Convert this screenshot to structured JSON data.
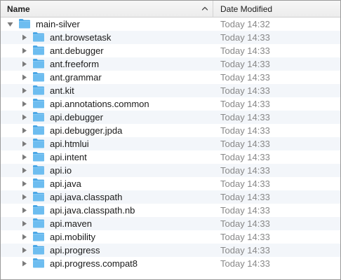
{
  "header": {
    "name_label": "Name",
    "date_label": "Date Modified",
    "sort_icon": "chevron-up-icon"
  },
  "colors": {
    "folder": "#5fb5ec",
    "stripe": "#f3f6fa",
    "date_text": "#888888"
  },
  "rows": [
    {
      "name": "main-silver",
      "date": "Today 14:32",
      "expanded": true,
      "level": 0
    },
    {
      "name": "ant.browsetask",
      "date": "Today 14:33",
      "expanded": false,
      "level": 1
    },
    {
      "name": "ant.debugger",
      "date": "Today 14:33",
      "expanded": false,
      "level": 1
    },
    {
      "name": "ant.freeform",
      "date": "Today 14:33",
      "expanded": false,
      "level": 1
    },
    {
      "name": "ant.grammar",
      "date": "Today 14:33",
      "expanded": false,
      "level": 1
    },
    {
      "name": "ant.kit",
      "date": "Today 14:33",
      "expanded": false,
      "level": 1
    },
    {
      "name": "api.annotations.common",
      "date": "Today 14:33",
      "expanded": false,
      "level": 1
    },
    {
      "name": "api.debugger",
      "date": "Today 14:33",
      "expanded": false,
      "level": 1
    },
    {
      "name": "api.debugger.jpda",
      "date": "Today 14:33",
      "expanded": false,
      "level": 1
    },
    {
      "name": "api.htmlui",
      "date": "Today 14:33",
      "expanded": false,
      "level": 1
    },
    {
      "name": "api.intent",
      "date": "Today 14:33",
      "expanded": false,
      "level": 1
    },
    {
      "name": "api.io",
      "date": "Today 14:33",
      "expanded": false,
      "level": 1
    },
    {
      "name": "api.java",
      "date": "Today 14:33",
      "expanded": false,
      "level": 1
    },
    {
      "name": "api.java.classpath",
      "date": "Today 14:33",
      "expanded": false,
      "level": 1
    },
    {
      "name": "api.java.classpath.nb",
      "date": "Today 14:33",
      "expanded": false,
      "level": 1
    },
    {
      "name": "api.maven",
      "date": "Today 14:33",
      "expanded": false,
      "level": 1
    },
    {
      "name": "api.mobility",
      "date": "Today 14:33",
      "expanded": false,
      "level": 1
    },
    {
      "name": "api.progress",
      "date": "Today 14:33",
      "expanded": false,
      "level": 1
    },
    {
      "name": "api.progress.compat8",
      "date": "Today 14:33",
      "expanded": false,
      "level": 1
    }
  ]
}
